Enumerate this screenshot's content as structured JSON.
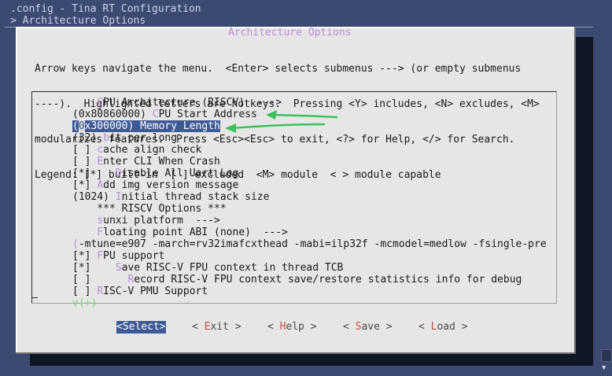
{
  "window": {
    "title": ".config - Tina RT Configuration",
    "subtitle": "> Architecture Options"
  },
  "dialog": {
    "title": "Architecture Options",
    "help_lines": [
      "Arrow keys navigate the menu.  <Enter> selects submenus ---> (or empty submenus",
      "----).  Highlighted letters are hotkeys.  Pressing <Y> includes, <N> excludes, <M>",
      "modularizes features.  Press <Esc><Esc> to exit, <?> for Help, </> for Search.",
      "Legend: [*] built-in  [ ] excluded  <M> module  < > module capable"
    ]
  },
  "menu": {
    "items": [
      {
        "pre": "    ",
        "hotkey": "C",
        "post": "PU Architecture (RISCV)  --->"
      },
      {
        "pre": "(0x80860000) ",
        "hotkey": "C",
        "post": "PU Start Address"
      },
      {
        "pre": "(",
        "hotkey": "0",
        "post": "x300000) Memory Length",
        "selected": true
      },
      {
        "pre": "(32) ",
        "hotkey": "b",
        "post": "it per long"
      },
      {
        "pre": "[ ] ",
        "hotkey": "c",
        "post": "ache align check"
      },
      {
        "pre": "[ ] ",
        "hotkey": "E",
        "post": "nter CLI When Crash"
      },
      {
        "pre": "[*]    ",
        "hotkey": "D",
        "post": "isable All Uart Log"
      },
      {
        "pre": "[*] ",
        "hotkey": "A",
        "post": "dd img version message"
      },
      {
        "pre": "(1024) ",
        "hotkey": "I",
        "post": "nitial thread stack size"
      },
      {
        "pre": "    *** RISCV Options ***",
        "hotkey": "",
        "post": ""
      },
      {
        "pre": "    ",
        "hotkey": "s",
        "post": "unxi platform  --->"
      },
      {
        "pre": "    ",
        "hotkey": "F",
        "post": "loating point ABI (none)  --->"
      },
      {
        "pre": "",
        "hotkey": "(",
        "post": "-mtune=e907 -march=rv32imafcxthead -mabi=ilp32f -mcmodel=medlow -fsingle-pre"
      },
      {
        "pre": "[*] ",
        "hotkey": "F",
        "post": "PU support"
      },
      {
        "pre": "[*]    ",
        "hotkey": "S",
        "post": "ave RISC-V FPU context in thread TCB"
      },
      {
        "pre": "[ ]      ",
        "hotkey": "R",
        "post": "ecord RISC-V FPU context save/restore statistics info for debug"
      },
      {
        "pre": "[ ] ",
        "hotkey": "R",
        "post": "ISC-V PMU Support"
      }
    ],
    "more_indicator": "v(+)"
  },
  "buttons": {
    "select": {
      "open": "<",
      "label": "Select",
      "close": ">"
    },
    "exit": {
      "open": "< ",
      "hotkey": "E",
      "rest": "xit",
      "close": " >"
    },
    "help": {
      "open": "< ",
      "hotkey": "H",
      "rest": "elp",
      "close": " >"
    },
    "save": {
      "open": "< ",
      "hotkey": "S",
      "rest": "ave",
      "close": " >"
    },
    "load": {
      "open": "< ",
      "hotkey": "L",
      "rest": "oad",
      "close": " >"
    }
  },
  "colors": {
    "terminal_bg": "#3c4a72",
    "dialog_bg": "#e6e6e6",
    "hotkey": "#b88ed8",
    "selection_bg": "#3e5a96",
    "annotation_arrow": "#3cc25a"
  }
}
